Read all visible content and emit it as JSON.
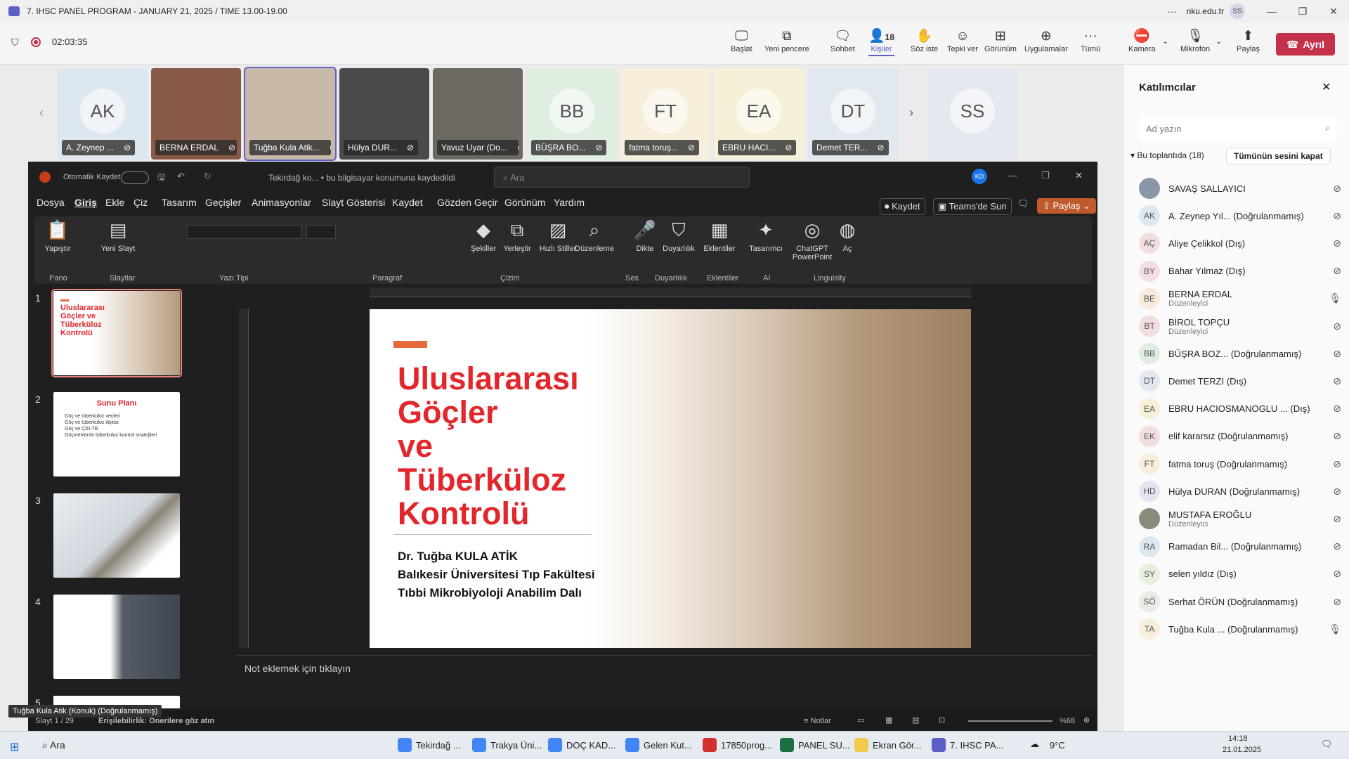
{
  "window": {
    "title": "7. IHSC PANEL PROGRAM - JANUARY 21, 2025 / TIME 13.00-19.00",
    "domain": "nku.edu.tr",
    "user_initials": "SS"
  },
  "meeting": {
    "timer": "02:03:35",
    "buttons": [
      {
        "label": "Başlat",
        "icon": "present-icon"
      },
      {
        "label": "Yeni pencere",
        "icon": "pop-out-icon"
      },
      {
        "label": "Sohbet",
        "icon": "chat-icon"
      },
      {
        "label": "Kişiler",
        "icon": "people-icon",
        "count": "18"
      },
      {
        "label": "Söz iste",
        "icon": "raise-hand-icon"
      },
      {
        "label": "Tepki ver",
        "icon": "react-icon"
      },
      {
        "label": "Görünüm",
        "icon": "view-icon"
      },
      {
        "label": "Uygulamalar",
        "icon": "apps-icon"
      },
      {
        "label": "Tümü",
        "icon": "more-icon"
      },
      {
        "label": "Kamera",
        "icon": "camera-off-icon"
      },
      {
        "label": "Mikrofon",
        "icon": "mic-off-icon"
      },
      {
        "label": "Paylaş",
        "icon": "share-icon"
      }
    ],
    "leave_label": "Ayrıl"
  },
  "tiles": [
    {
      "initials": "AK",
      "name": "A. Zeynep ...",
      "bg": "#dde7f0"
    },
    {
      "initials": "",
      "name": "BERNA ERDAL",
      "bg": "#8a5a48"
    },
    {
      "initials": "",
      "name": "Tuğba Kula Atik...",
      "bg": "#c8b8a8"
    },
    {
      "initials": "",
      "name": "Hülya DUR...",
      "bg": "#4a4a4a"
    },
    {
      "initials": "",
      "name": "Yavuz Uyar (Do...",
      "bg": "#6c6a60"
    },
    {
      "initials": "BB",
      "name": "BÜŞRA BO...",
      "bg": "#dfeee0"
    },
    {
      "initials": "FT",
      "name": "fatma toruş...",
      "bg": "#f7eedb"
    },
    {
      "initials": "EA",
      "name": "EBRU HACI...",
      "bg": "#f7f0d8"
    },
    {
      "initials": "DT",
      "name": "Demet TER...",
      "bg": "#e2e8f0"
    },
    {
      "initials": "SS",
      "name": "",
      "bg": "#e4e8f0"
    }
  ],
  "ppt": {
    "autosave": "Otomatik Kaydet",
    "doc_title": "Tekirdağ ko...  •  bu bilgisayar konumuna kaydedildi",
    "search_placeholder": "Ara",
    "avatar": "KD",
    "menu": [
      "Dosya",
      "Giriş",
      "Ekle",
      "Çiz",
      "Tasarım",
      "Geçişler",
      "Animasyonlar",
      "Slayt Gösterisi",
      "Kaydet",
      "Gözden Geçir",
      "Görünüm",
      "Yardım"
    ],
    "kaydet": "Kaydet",
    "teams": "Teams'de Sun",
    "paylas": "Paylaş",
    "ribbon_groups": [
      "Pano",
      "Slaytlar",
      "Yazı Tipi",
      "Paragraf",
      "Çizim",
      "Ses",
      "Duyarlılık",
      "Eklentiler",
      "AI",
      "Linguisity"
    ],
    "ribbon_buttons": [
      "Yapıştır",
      "Yeni Slayt",
      "Şekiller",
      "Yerleştir",
      "Hızlı Stiller",
      "Düzenleme",
      "Dikte",
      "Duyarlılık",
      "Eklentiler",
      "Tasarımcı",
      "ChatGPT PowerPoint",
      "Aç"
    ],
    "thumbnails": [
      {
        "num": "1",
        "title": "Uluslararası Göçler ve Tüberküloz Kontrolü"
      },
      {
        "num": "2",
        "title": "Sunu Planı",
        "items": [
          "Göç ve tüberküloz verileri",
          "Göç ve tüberküloz ilişkisi",
          "Göç ve ÇİD-TB",
          "Göçmenlerde tüberküloz kontrol stratejileri"
        ]
      },
      {
        "num": "3",
        "title": ""
      },
      {
        "num": "4",
        "title": ""
      },
      {
        "num": "5",
        "title": ""
      }
    ],
    "slide": {
      "title_lines": [
        "Uluslararası",
        "Göçler",
        "ve",
        "Tüberküloz",
        "Kontrolü"
      ],
      "author": "Dr. Tuğba KULA ATİK",
      "affil1": "Balıkesir Üniversitesi Tıp Fakültesi",
      "affil2": "Tıbbi Mikrobiyoloji Anabilim Dalı"
    },
    "notes_placeholder": "Not eklemek için tıklayın",
    "status": {
      "slide": "Slayt 1 / 29",
      "access": "Erişilebilirlik: Önerilere göz atın",
      "notes": "Notlar",
      "zoom": "%68"
    },
    "tooltip": "Tuğba Kula Atik (Konuk) (Doğrulanmamış)"
  },
  "participants": {
    "title": "Katılımcılar",
    "search_placeholder": "Ad yazın",
    "section": "Bu toplantıda (18)",
    "mute_all": "Tümünün sesini kapat",
    "list": [
      {
        "ini": "",
        "name": "SAVAŞ SALLAYICI",
        "sub": "",
        "bg": "#8a97a8",
        "mic": "off"
      },
      {
        "ini": "AK",
        "name": "A. Zeynep Yıl... (Doğrulanmamış)",
        "sub": "",
        "bg": "#dde7f0",
        "mic": "off"
      },
      {
        "ini": "AÇ",
        "name": "Aliye Çelikkol (Dış)",
        "sub": "",
        "bg": "#f3dede",
        "mic": "off"
      },
      {
        "ini": "BY",
        "name": "Bahar Yılmaz (Dış)",
        "sub": "",
        "bg": "#f3dee6",
        "mic": "off"
      },
      {
        "ini": "BE",
        "name": "BERNA ERDAL",
        "sub": "Düzenleyici",
        "bg": "#f9eadb",
        "mic": "on"
      },
      {
        "ini": "BT",
        "name": "BİROL TOPÇU",
        "sub": "Düzenleyici",
        "bg": "#f3dede",
        "mic": "off"
      },
      {
        "ini": "BB",
        "name": "BÜŞRA BOZ... (Doğrulanmamış)",
        "sub": "",
        "bg": "#dfeee0",
        "mic": "off"
      },
      {
        "ini": "DT",
        "name": "Demet TERZI (Dış)",
        "sub": "",
        "bg": "#e2e8f0",
        "mic": "off"
      },
      {
        "ini": "EA",
        "name": "EBRU HACIOSMANOGLU ... (Dış)",
        "sub": "",
        "bg": "#f7f0d8",
        "mic": "off"
      },
      {
        "ini": "EK",
        "name": "elif kararsız (Doğrulanmamış)",
        "sub": "",
        "bg": "#f3dede",
        "mic": "off"
      },
      {
        "ini": "FT",
        "name": "fatma toruş (Doğrulanmamış)",
        "sub": "",
        "bg": "#f7eedb",
        "mic": "off"
      },
      {
        "ini": "HD",
        "name": "Hülya DURAN (Doğrulanmamış)",
        "sub": "",
        "bg": "#e4e4f0",
        "mic": "off"
      },
      {
        "ini": "",
        "name": "MUSTAFA EROĞLU",
        "sub": "Düzenleyici",
        "bg": "#8a8a7a",
        "mic": "off"
      },
      {
        "ini": "RA",
        "name": "Ramadan Bil... (Doğrulanmamış)",
        "sub": "",
        "bg": "#dde7f0",
        "mic": "off"
      },
      {
        "ini": "SY",
        "name": "selen yıldız (Dış)",
        "sub": "",
        "bg": "#e6f0dc",
        "mic": "off"
      },
      {
        "ini": "SÖ",
        "name": "Serhat ÖRÜN (Doğrulanmamış)",
        "sub": "",
        "bg": "#e8ece4",
        "mic": "off"
      },
      {
        "ini": "TA",
        "name": "Tuğba Kula ... (Doğrulanmamış)",
        "sub": "",
        "bg": "#f7eedb",
        "mic": "on"
      }
    ]
  },
  "taskbar": {
    "search": "Ara",
    "apps": [
      "Tekirdağ ...",
      "Trakya Üni...",
      "DOÇ KAD...",
      "Gelen Kut...",
      "17850prog...",
      "PANEL SU...",
      "Ekran Gör...",
      "7. IHSC PA..."
    ],
    "temp": "9°C",
    "time": "14:18",
    "date": "21.01.2025"
  }
}
